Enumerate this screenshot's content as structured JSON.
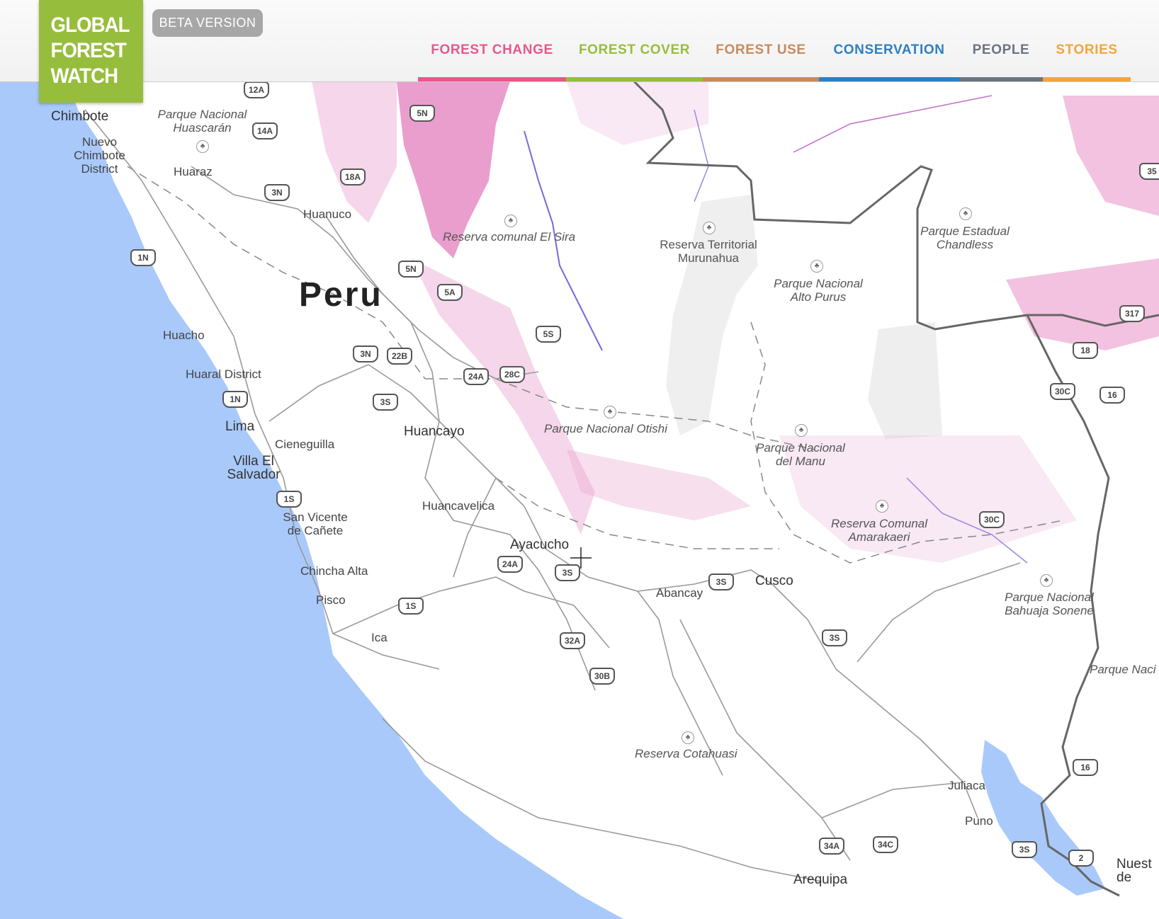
{
  "header": {
    "logo_lines": [
      "GLOBAL",
      "FOREST",
      "WATCH"
    ],
    "beta_label": "BETA VERSION",
    "nav": [
      {
        "label": "FOREST CHANGE",
        "color": "#e8578c"
      },
      {
        "label": "FOREST COVER",
        "color": "#97bd3d"
      },
      {
        "label": "FOREST USE",
        "color": "#c68a60"
      },
      {
        "label": "CONSERVATION",
        "color": "#2e7fc2"
      },
      {
        "label": "PEOPLE",
        "color": "#6a7583"
      },
      {
        "label": "STORIES",
        "color": "#f0a73c"
      }
    ]
  },
  "map": {
    "country": "Peru",
    "cities": [
      "Chimbote",
      "Nuevo Chimbote District",
      "Huaraz",
      "Huanuco",
      "Huacho",
      "Huaral District",
      "Lima",
      "Cieneguilla",
      "Villa El Salvador",
      "San Vicente de Cañete",
      "Chincha Alta",
      "Pisco",
      "Ica",
      "Huancayo",
      "Huancavelica",
      "Ayacucho",
      "Abancay",
      "Cusco",
      "Juliaca",
      "Puno",
      "Arequipa",
      "Nuest de"
    ],
    "parks": [
      "Parque Nacional Huascarán",
      "Reserva comunal El Sira",
      "Reserva Territorial Murunahua",
      "Parque Nacional Alto Purus",
      "Parque Estadual Chandless",
      "Parque Nacional Otishi",
      "Parque Nacional del Manu",
      "Reserva Comunal Amarakaeri",
      "Parque Nacional Bahuaja Sonene",
      "Parque Naci",
      "Reserva Cotahuasi"
    ],
    "shields": [
      "12A",
      "14A",
      "18A",
      "3N",
      "1N",
      "5N",
      "5N",
      "5A",
      "5S",
      "3N",
      "22B",
      "24A",
      "28C",
      "3S",
      "1N",
      "1S",
      "24A",
      "3S",
      "1S",
      "32A",
      "30B",
      "3S",
      "3S",
      "35",
      "317",
      "18",
      "30C",
      "16",
      "30C",
      "16",
      "34A",
      "34C",
      "3S",
      "2"
    ]
  },
  "colors": {
    "water": "#a9c9fb",
    "land": "#ffffff",
    "loss": "#d94fa6",
    "logo": "#97bd3d"
  }
}
